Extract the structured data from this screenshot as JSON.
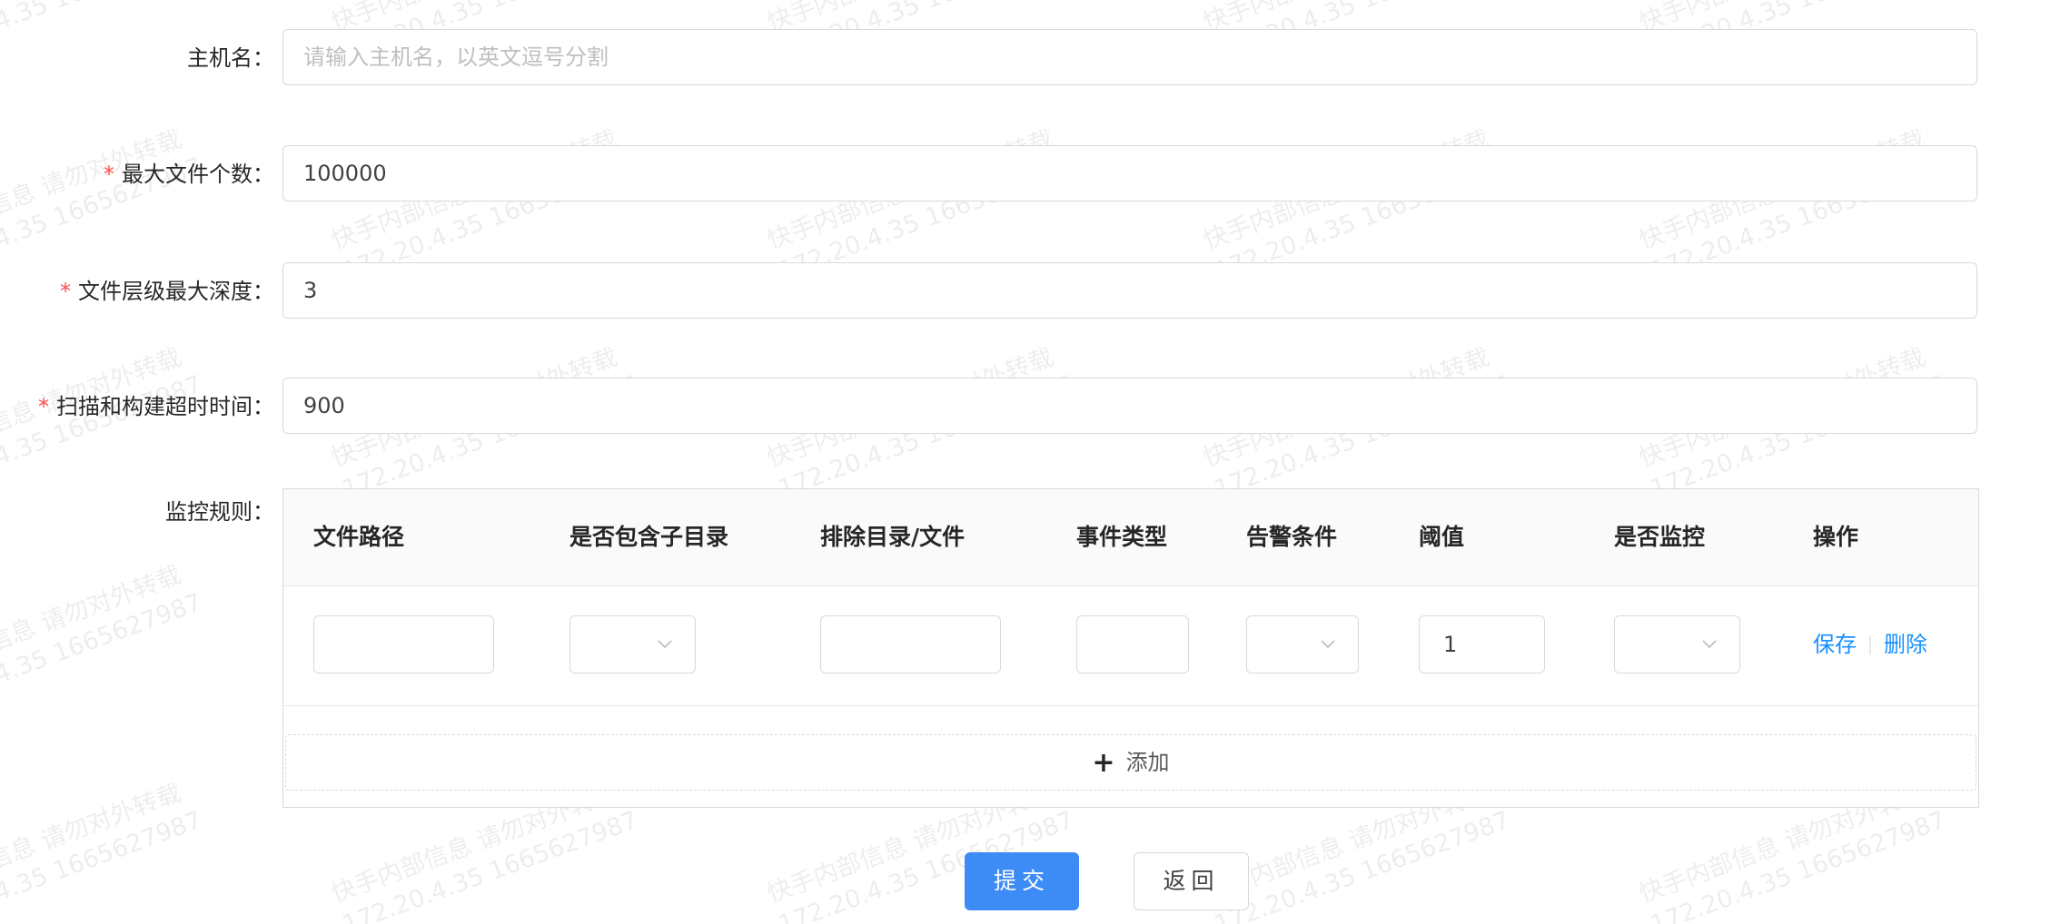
{
  "form": {
    "hostname": {
      "label": "主机名：",
      "required": false,
      "placeholder": "请输入主机名，以英文逗号分割",
      "value": ""
    },
    "max_files": {
      "label": "最大文件个数：",
      "required": true,
      "value": "100000"
    },
    "max_depth": {
      "label": "文件层级最大深度：",
      "required": true,
      "value": "3"
    },
    "scan_timeout": {
      "label": "扫描和构建超时时间：",
      "required": true,
      "value": "900"
    },
    "required_mark": "*"
  },
  "rules": {
    "label": "监控规则：",
    "columns": [
      "文件路径",
      "是否包含子目录",
      "排除目录/文件",
      "事件类型",
      "告警条件",
      "阈值",
      "是否监控",
      "操作"
    ],
    "row": {
      "file_path": "",
      "include_subdirs": "",
      "exclude": "",
      "event_type": "",
      "alert_condition": "",
      "threshold": "1",
      "monitor": "",
      "save_label": "保存",
      "delete_label": "删除"
    },
    "add_label": "添加"
  },
  "buttons": {
    "submit": "提交",
    "back": "返回"
  },
  "watermark": {
    "line1": "快手内部信息 请勿对外转载",
    "line2": "172.20.4.35 1665627987"
  },
  "colors": {
    "primary": "#3d8bf5",
    "link": "#1890ff",
    "required": "#ff4d4f",
    "border": "#d9d9d9"
  }
}
